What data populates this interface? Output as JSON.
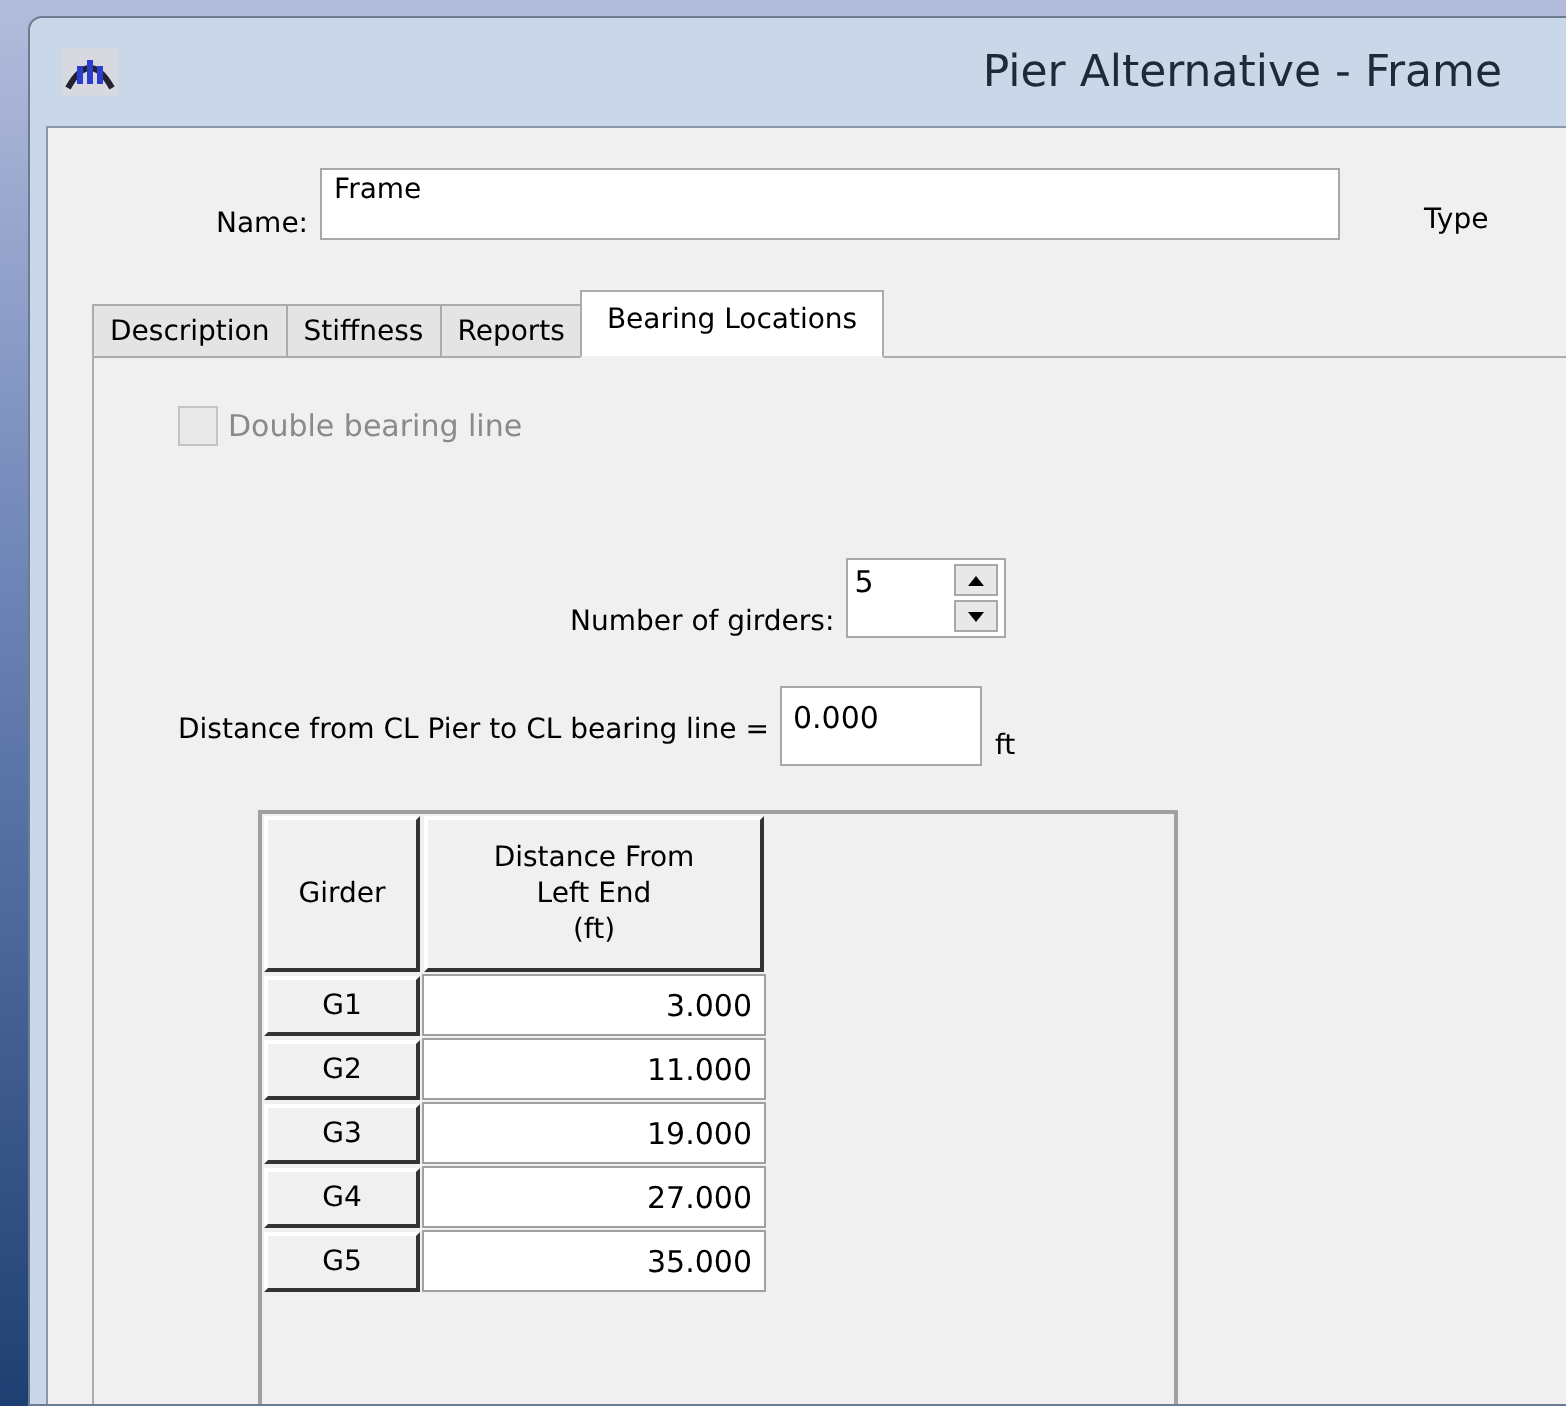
{
  "window": {
    "title": "Pier Alternative - Frame"
  },
  "name_field": {
    "label": "Name:",
    "value": "Frame"
  },
  "type_label": "Type",
  "tabs": [
    {
      "label": "Description",
      "selected": false
    },
    {
      "label": "Stiffness",
      "selected": false
    },
    {
      "label": "Reports",
      "selected": false
    },
    {
      "label": "Bearing Locations",
      "selected": true
    }
  ],
  "double_bearing": {
    "label": "Double bearing line",
    "checked": false,
    "disabled": true
  },
  "girders_count": {
    "label": "Number of girders:",
    "value": "5"
  },
  "distance": {
    "label": "Distance from CL Pier to CL bearing line =",
    "value": "0.000",
    "unit": "ft"
  },
  "table": {
    "columns": [
      "Girder",
      "Distance From\nLeft End\n(ft)"
    ],
    "rows": [
      [
        "G1",
        "3.000"
      ],
      [
        "G2",
        "11.000"
      ],
      [
        "G3",
        "19.000"
      ],
      [
        "G4",
        "27.000"
      ],
      [
        "G5",
        "35.000"
      ]
    ]
  }
}
